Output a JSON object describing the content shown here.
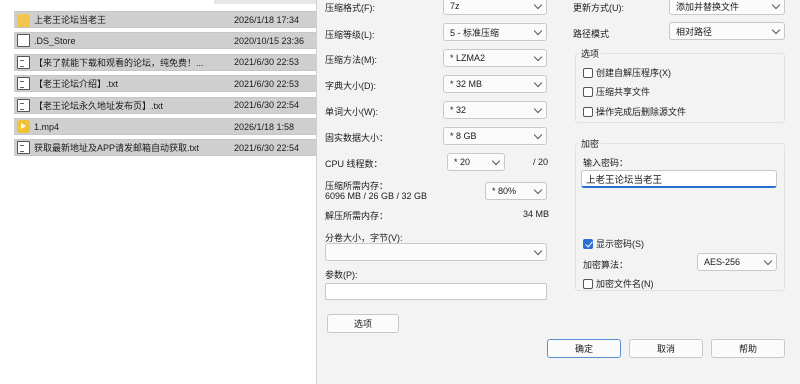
{
  "files": [
    {
      "name": "上老王论坛当老王",
      "date": "2026/1/18 17:34",
      "icon": "folder-icon",
      "style": "sel"
    },
    {
      "name": ".DS_Store",
      "date": "2020/10/15 23:36",
      "icon": "file-icon",
      "style": "sel"
    },
    {
      "name": "【来了就能下载和观看的论坛，纯免费！...",
      "date": "2021/6/30 22:53",
      "icon": "text-file-icon",
      "style": "sel"
    },
    {
      "name": "【老王论坛介绍】.txt",
      "date": "2021/6/30 22:53",
      "icon": "text-file-icon",
      "style": "sel"
    },
    {
      "name": "【老王论坛永久地址发布页】.txt",
      "date": "2021/6/30 22:54",
      "icon": "text-file-icon",
      "style": "sel"
    },
    {
      "name": "1.mp4",
      "date": "2026/1/18 1:58",
      "icon": "video-file-icon",
      "style": "sel"
    },
    {
      "name": "获取最新地址及APP请发邮箱自动获取.txt",
      "date": "2021/6/30 22:54",
      "icon": "text-file-icon",
      "style": "sel"
    }
  ],
  "left": {
    "format_label": "压缩格式(F):",
    "format_value": "7z",
    "level_label": "压缩等级(L):",
    "level_value": "5 - 标准压缩",
    "method_label": "压缩方法(M):",
    "method_value": "* LZMA2",
    "dict_label": "字典大小(D):",
    "dict_value": "* 32 MB",
    "word_label": "单词大小(W):",
    "word_value": "* 32",
    "solid_label": "固实数据大小：",
    "solid_value": "* 8 GB",
    "cpu_label": "CPU 线程数：",
    "cpu_value": "* 20",
    "cpu_max": "/ 20",
    "mem_label": "压缩所需内存：",
    "mem_detail": "6096 MB / 26 GB / 32 GB",
    "mem_value": "* 80%",
    "decomp_label": "解压所需内存：",
    "decomp_value": "34 MB",
    "volume_label": "分卷大小，字节(V):",
    "params_label": "参数(P):",
    "options_button": "选项"
  },
  "right": {
    "update_label": "更新方式(U):",
    "update_value": "添加并替换文件",
    "path_label": "路径模式",
    "path_value": "相对路径",
    "options_group": "选项",
    "opt_sfx": "创建自解压程序(X)",
    "opt_shared": "压缩共享文件",
    "opt_delete": "操作完成后删除源文件",
    "enc_group": "加密",
    "pwd_label": "输入密码：",
    "pwd_value": "上老王论坛当老王",
    "show_pwd": "显示密码(S)",
    "algo_label": "加密算法：",
    "algo_value": "AES-256",
    "enc_names": "加密文件名(N)"
  },
  "buttons": {
    "ok": "确定",
    "cancel": "取消",
    "help": "帮助"
  },
  "state": {
    "show_pwd_checked": true,
    "opt_sfx_checked": false,
    "opt_shared_checked": false,
    "opt_delete_checked": false,
    "enc_names_checked": false
  }
}
